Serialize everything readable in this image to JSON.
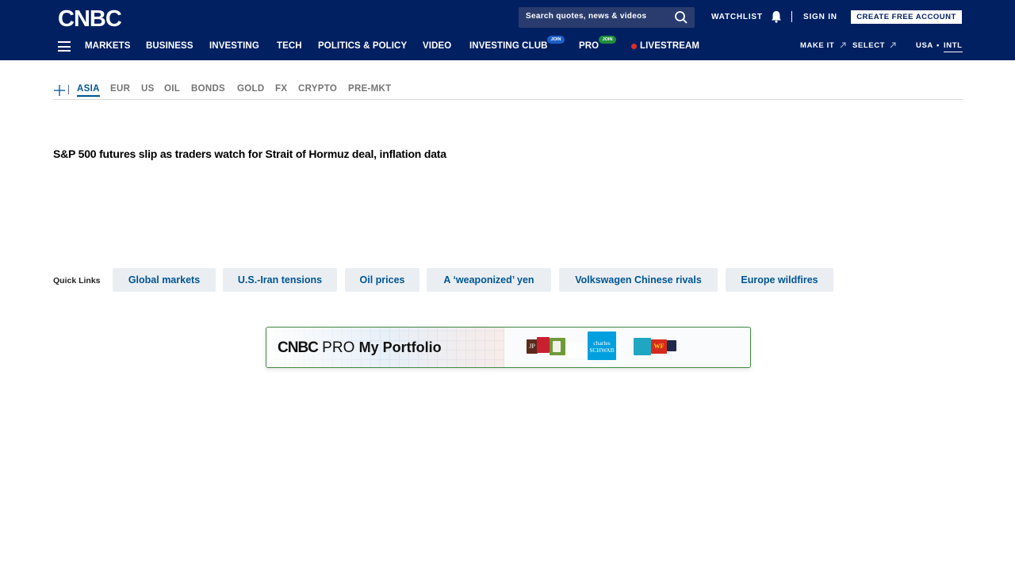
{
  "header": {
    "logo_text": "CNBC",
    "search": {
      "placeholder": "Search quotes, news & videos"
    },
    "watchlist_label": "WATCHLIST",
    "signin_label": "SIGN IN",
    "create_account_label": "CREATE FREE ACCOUNT",
    "nav": [
      {
        "label": "MARKETS"
      },
      {
        "label": "BUSINESS"
      },
      {
        "label": "INVESTING"
      },
      {
        "label": "TECH"
      },
      {
        "label": "POLITICS & POLICY"
      },
      {
        "label": "VIDEO"
      },
      {
        "label": "INVESTING CLUB",
        "badge": "JOIN"
      },
      {
        "label": "PRO",
        "badge": "JOIN"
      },
      {
        "label": "LIVESTREAM"
      }
    ],
    "right_nav": {
      "make_it": "MAKE IT",
      "select": "SELECT",
      "usa": "USA",
      "sep": "•",
      "intl": "INTL"
    },
    "colors": {
      "background": "#002062",
      "club_badge": "#1b5fc9",
      "pro_badge": "#1f8f3c",
      "live_dot": "#e12b2b"
    }
  },
  "market_tabs": {
    "items": [
      "ASIA",
      "EUR",
      "US",
      "OIL",
      "BONDS",
      "GOLD",
      "FX",
      "CRYPTO",
      "PRE-MKT"
    ],
    "active": "ASIA"
  },
  "headline": "S&P 500 futures slip as traders watch for Strait of Hormuz deal, inflation data",
  "quick_links": {
    "label": "Quick Links",
    "items": [
      "Global markets",
      "U.S.-Iran tensions",
      "Oil prices",
      "A ‘weaponized’ yen",
      "Volkswagen Chinese rivals",
      "Europe wildfires"
    ]
  },
  "promo": {
    "brand": "CNBC",
    "pro": "PRO",
    "title": "My Portfolio",
    "logos": {
      "jp": "JP",
      "schwab": "charles SCHWAB",
      "wf": "WF"
    }
  }
}
